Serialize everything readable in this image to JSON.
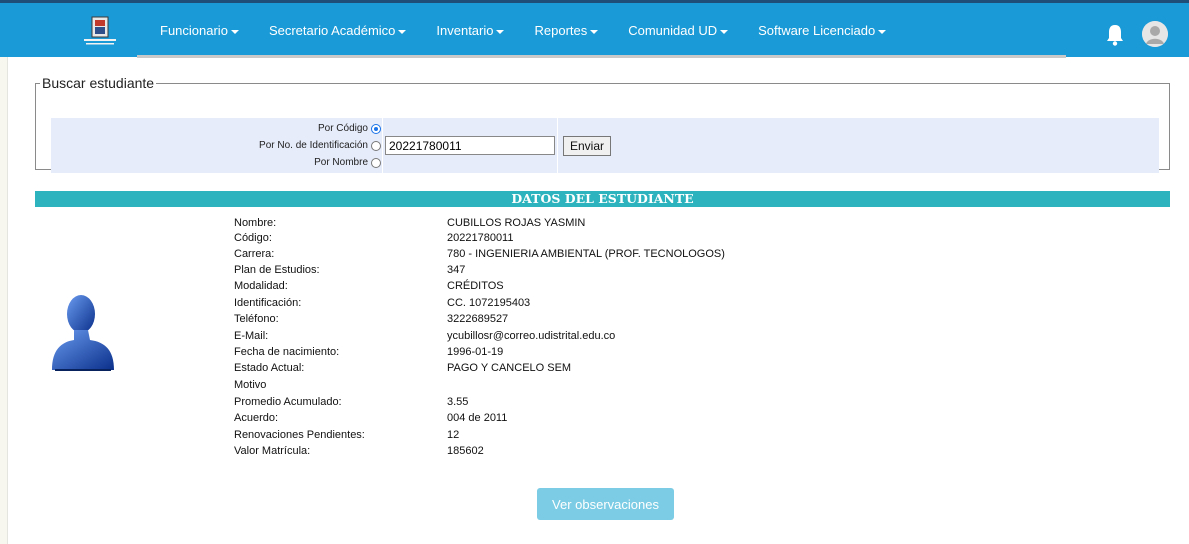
{
  "nav": {
    "menu": [
      {
        "label": "Funcionario"
      },
      {
        "label": "Secretario Académico"
      },
      {
        "label": "Inventario"
      },
      {
        "label": "Reportes"
      },
      {
        "label": "Comunidad UD"
      },
      {
        "label": "Software Licenciado"
      }
    ],
    "icons": [
      "university-logo",
      "bell-icon",
      "user-avatar-icon"
    ]
  },
  "search": {
    "legend": "Buscar estudiante",
    "options": [
      {
        "label": "Por Código",
        "checked": true
      },
      {
        "label": "Por No. de Identificación",
        "checked": false
      },
      {
        "label": "Por Nombre",
        "checked": false
      }
    ],
    "input_value": "20221780011",
    "submit_label": "Enviar"
  },
  "student": {
    "section_title": "DATOS DEL ESTUDIANTE",
    "fields": [
      {
        "label": "Nombre:",
        "value": "CUBILLOS ROJAS YASMIN"
      },
      {
        "label": "Código:",
        "value": "20221780011"
      },
      {
        "label": "Carrera:",
        "value": "780 - INGENIERIA AMBIENTAL (PROF. TECNOLOGOS)"
      },
      {
        "label": "Plan de Estudios:",
        "value": "347"
      },
      {
        "label": "Modalidad:",
        "value": "CRÉDITOS"
      },
      {
        "label": "Identificación:",
        "value": "CC. 1072195403"
      },
      {
        "label": "Teléfono:",
        "value": "3222689527"
      },
      {
        "label": "E-Mail:",
        "value": "ycubillosr@correo.udistrital.edu.co"
      },
      {
        "label": "Fecha de nacimiento:",
        "value": "1996-01-19"
      },
      {
        "label": "Estado Actual:",
        "value": "PAGO Y CANCELO SEM"
      },
      {
        "label": "Motivo",
        "value": ""
      },
      {
        "label": "Promedio Acumulado:",
        "value": "3.55"
      },
      {
        "label": "Acuerdo:",
        "value": "004 de 2011"
      },
      {
        "label": "Renovaciones Pendientes:",
        "value": "12"
      },
      {
        "label": "Valor Matrícula:",
        "value": "185602"
      }
    ],
    "observations_button": "Ver observaciones"
  }
}
